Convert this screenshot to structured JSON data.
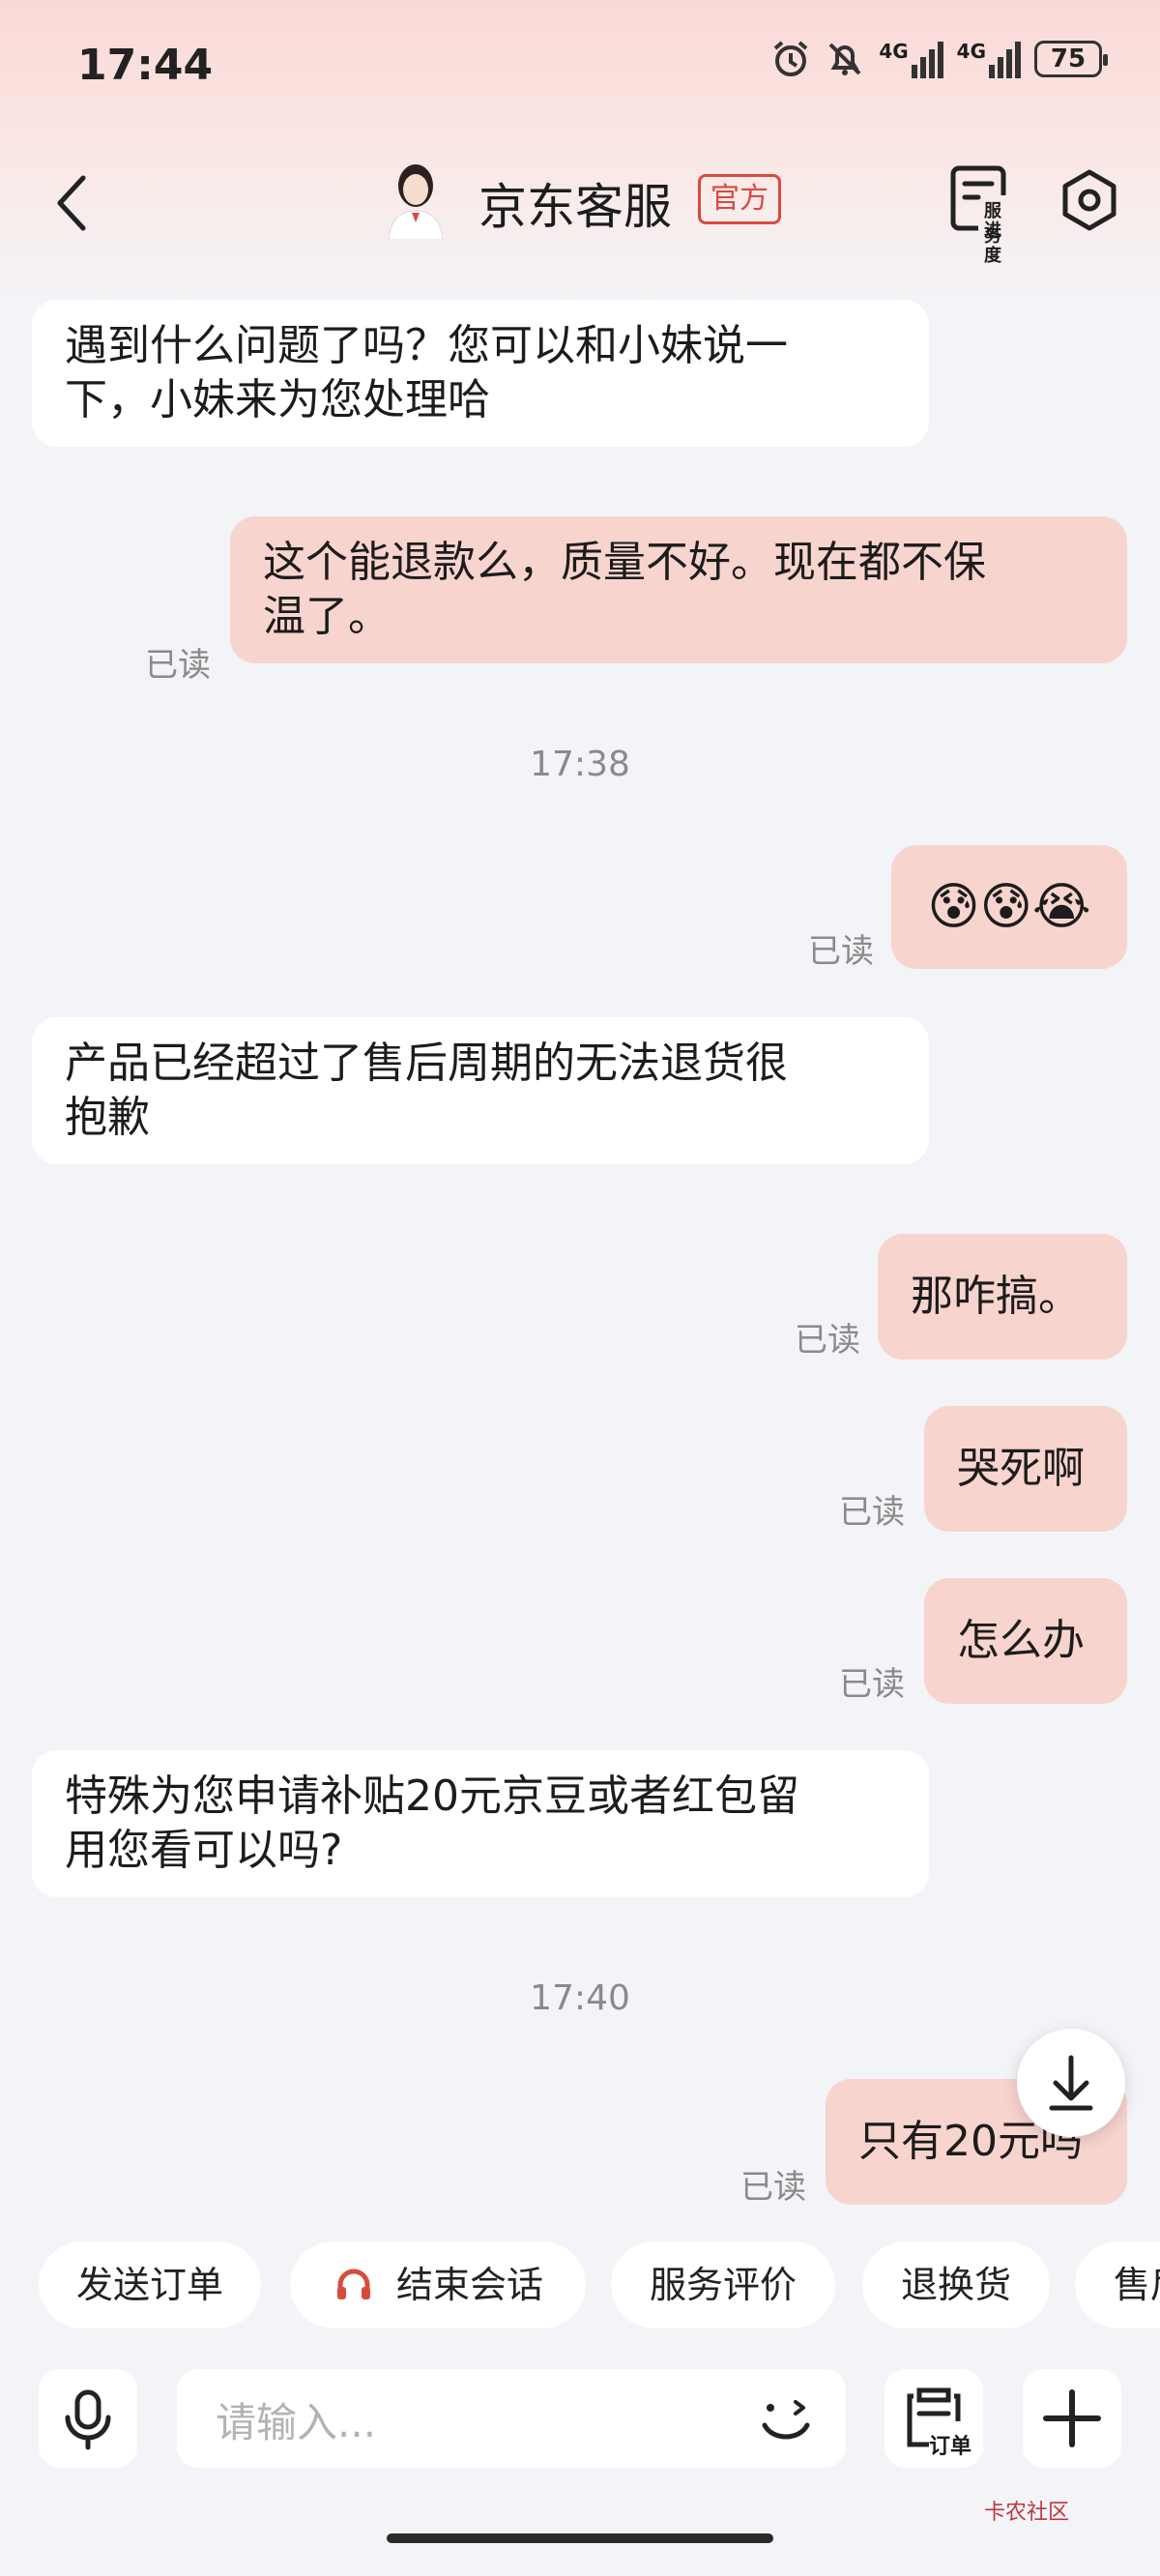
{
  "status_bar": {
    "time": "17:44",
    "network_1": "4G",
    "network_2": "4G",
    "battery": "75"
  },
  "header": {
    "title": "京东客服",
    "badge": "官方",
    "service_progress_label_1": "服务",
    "service_progress_label_2": "进度"
  },
  "messages": [
    {
      "side": "in",
      "text_1": "遇到什么问题了吗？您可以和小妹说一",
      "text_2": "下，小妹来为您处理哈"
    },
    {
      "side": "out",
      "read": "已读",
      "text_1": "这个能退款么，质量不好。现在都不保",
      "text_2": "温了。"
    },
    {
      "timestamp": "17:38"
    },
    {
      "side": "out",
      "read": "已读",
      "emoji": "😰😰😭"
    },
    {
      "side": "in",
      "text_1": "产品已经超过了售后周期的无法退货很",
      "text_2": "抱歉"
    },
    {
      "side": "out",
      "read": "已读",
      "text": "那咋搞。"
    },
    {
      "side": "out",
      "read": "已读",
      "text": "哭死啊"
    },
    {
      "side": "out",
      "read": "已读",
      "text": "怎么办"
    },
    {
      "side": "in",
      "text_1": "特殊为您申请补贴20元京豆或者红包留",
      "text_2": "用您看可以吗?"
    },
    {
      "timestamp": "17:40"
    },
    {
      "side": "out",
      "read": "已读",
      "text": "只有20元吗"
    }
  ],
  "quick_actions": [
    "发送订单",
    "结束会话",
    "服务评价",
    "退换货",
    "售后"
  ],
  "input": {
    "placeholder": "请输入...",
    "order_label": "订单"
  },
  "watermark": "卡农社区",
  "colors": {
    "accent": "#d94a3e",
    "outgoing_bubble": "#f8d4cf",
    "background": "#f3f4f8"
  }
}
